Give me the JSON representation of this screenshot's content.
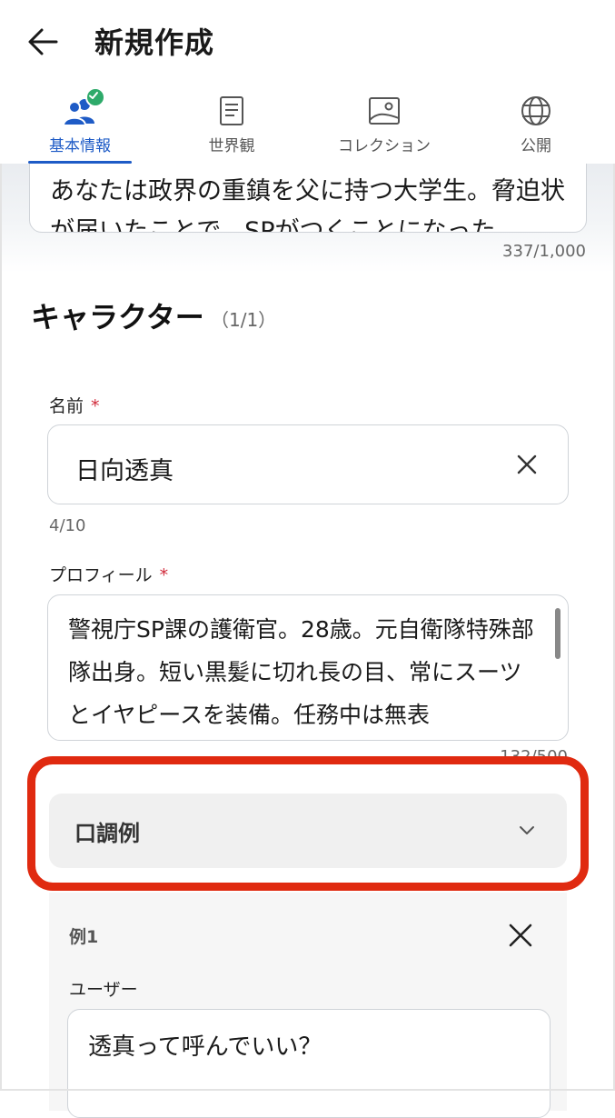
{
  "header": {
    "title": "新規作成"
  },
  "tabs": [
    {
      "label": "基本情報",
      "icon": "users-icon",
      "active": true,
      "completed": true
    },
    {
      "label": "世界観",
      "icon": "document-icon"
    },
    {
      "label": "コレクション",
      "icon": "image-icon"
    },
    {
      "label": "公開",
      "icon": "globe-icon"
    }
  ],
  "intro": {
    "text_partial": "あなたは政界の重鎮を父に持つ大学生。脅迫状が届いたことで、SPがつくことになった。",
    "counter": "337/1,000"
  },
  "character_section": {
    "title": "キャラクター",
    "count": "（1/1）"
  },
  "name_field": {
    "label": "名前",
    "required_mark": "*",
    "value": "日向透真",
    "counter": "4/10"
  },
  "profile_field": {
    "label": "プロフィール",
    "required_mark": "*",
    "value": "警視庁SP課の護衛官。28歳。元自衛隊特殊部隊出身。短い黒髪に切れ長の目、常にスーツとイヤピースを装備。任務中は無表",
    "counter": "132/500"
  },
  "speech_examples": {
    "label": "口調例",
    "example_title": "例1",
    "user_label": "ユーザー",
    "user_value": "透真って呼んでいい？"
  },
  "colors": {
    "accent": "#1e5bc6",
    "highlight": "#e02a10",
    "required": "#d02a3a",
    "badge": "#2eaa6a"
  }
}
